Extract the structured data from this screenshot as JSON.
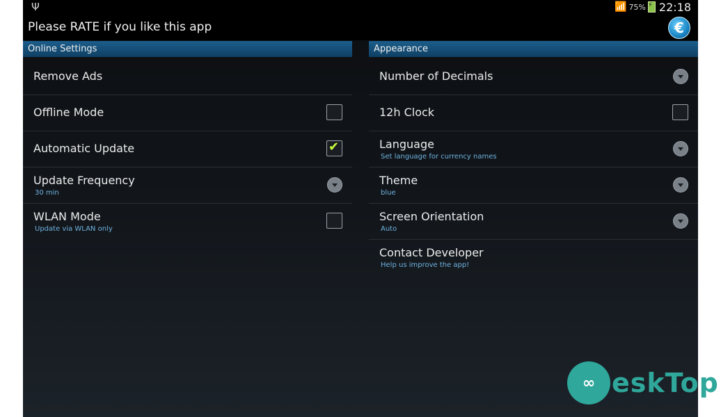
{
  "status_bar": {
    "usb_icon": "usb-icon",
    "wifi_icon": "wifi-icon",
    "battery_percent": "75%",
    "battery_icon": "battery-charging-icon",
    "time": "22:18"
  },
  "action_bar": {
    "title": "Please RATE if you like this app",
    "currency_icon": "euro-icon",
    "currency_symbol": "€"
  },
  "online_settings": {
    "header": "Online Settings",
    "items": [
      {
        "title": "Remove Ads"
      },
      {
        "title": "Offline Mode",
        "control": "checkbox",
        "checked": false
      },
      {
        "title": "Automatic Update",
        "control": "checkbox",
        "checked": true
      },
      {
        "title": "Update Frequency",
        "subtitle": "30 min",
        "control": "dropdown"
      },
      {
        "title": "WLAN Mode",
        "subtitle": "Update via WLAN only",
        "control": "checkbox",
        "checked": false
      }
    ]
  },
  "appearance": {
    "header": "Appearance",
    "items": [
      {
        "title": "Number of Decimals",
        "control": "dropdown"
      },
      {
        "title": "12h Clock",
        "control": "checkbox",
        "checked": false
      },
      {
        "title": "Language",
        "subtitle": "Set language for currency names",
        "control": "dropdown"
      },
      {
        "title": "Theme",
        "subtitle": "blue",
        "control": "dropdown"
      },
      {
        "title": "Screen Orientation",
        "subtitle": "Auto",
        "control": "dropdown"
      },
      {
        "title": "Contact Developer",
        "subtitle": "Help us improve the app!"
      }
    ]
  },
  "watermark": {
    "brand": "DeskTop",
    "brand_rest": "eskTop"
  },
  "colors": {
    "section_header": "#1c5e8c",
    "subtitle_text": "#6fb3e0",
    "checkmark": "#c6ff3a",
    "watermark": "#2fa79b"
  }
}
